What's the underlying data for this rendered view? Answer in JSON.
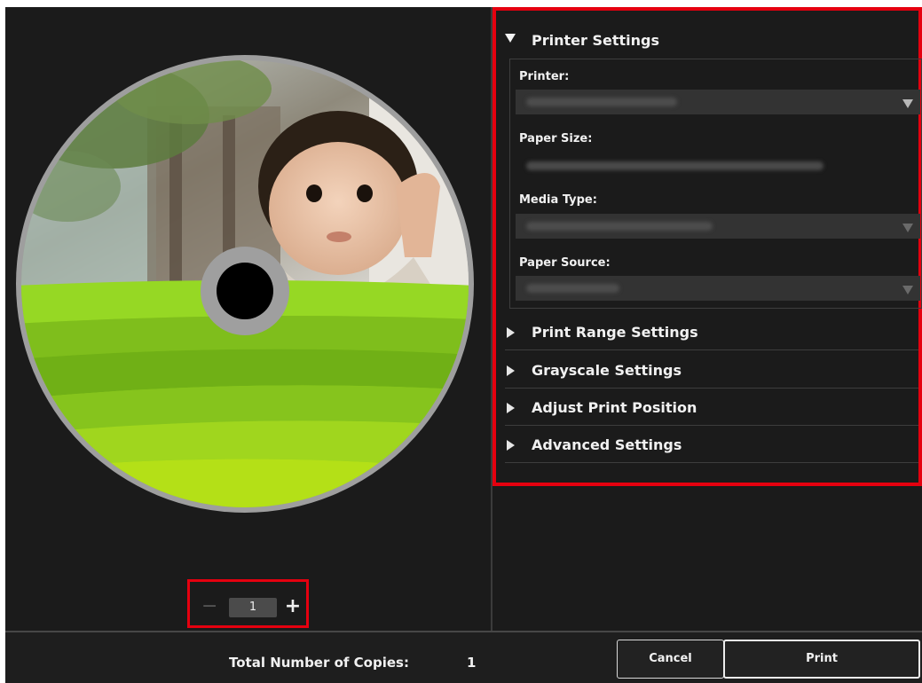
{
  "preview": {
    "copies_value": "1",
    "decrement_glyph": "−",
    "increment_glyph": "+"
  },
  "settings": {
    "printer_settings": {
      "title": "Printer Settings",
      "printer_label": "Printer:",
      "paper_size_label": "Paper Size:",
      "media_type_label": "Media Type:",
      "paper_source_label": "Paper Source:"
    },
    "sections": [
      {
        "label": "Print Range Settings"
      },
      {
        "label": "Grayscale Settings"
      },
      {
        "label": "Adjust Print Position"
      },
      {
        "label": "Advanced Settings"
      }
    ]
  },
  "footer": {
    "total_label": "Total Number of Copies:",
    "total_value": "1",
    "cancel_label": "Cancel",
    "print_label": "Print"
  },
  "colors": {
    "highlight": "#e5000f",
    "background": "#1b1b1b",
    "disc_green": "#8ccd1e"
  }
}
